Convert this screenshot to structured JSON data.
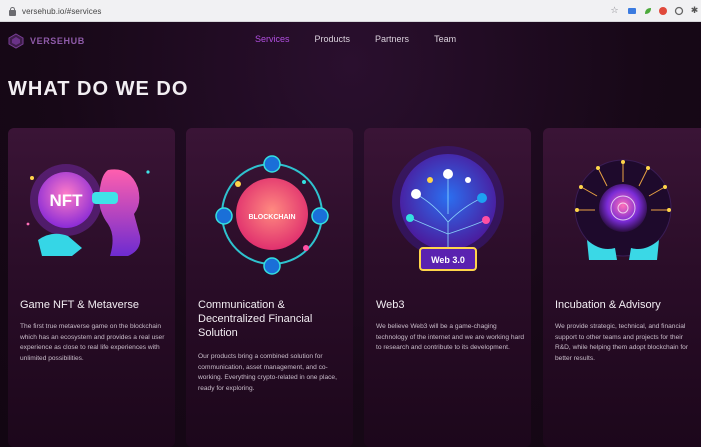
{
  "browser": {
    "url": "versehub.io/#services"
  },
  "nav": {
    "logo_text": "VERSEHUB",
    "links": [
      {
        "label": "Services",
        "active": true
      },
      {
        "label": "Products",
        "active": false
      },
      {
        "label": "Partners",
        "active": false
      },
      {
        "label": "Team",
        "active": false
      }
    ]
  },
  "section": {
    "heading": "WHAT DO WE DO"
  },
  "cards": [
    {
      "title": "Game NFT & Metaverse",
      "badge": "NFT",
      "description": "The first true metaverse game on the blockchain which has an ecosystem and provides a real user experience as close to real life experiences with unlimited possibilities."
    },
    {
      "title": "Communication & Decentralized Financial Solution",
      "badge": "BLOCKCHAIN",
      "description": "Our products bring a combined solution for communication, asset management, and co-working. Everything crypto-related in one place, ready for exploring."
    },
    {
      "title": "Web3",
      "badge": "Web 3.0",
      "description": "We believe Web3 will be a game-chaging technology of the internet and we are working hard to research and contribute to its development."
    },
    {
      "title": "Incubation & Advisory",
      "badge": "",
      "description": "We provide strategic, technical, and financial support to other teams and projects for their R&D, while helping them adopt blockchain for better results."
    }
  ],
  "colors": {
    "background": "#170817",
    "card": "#2a0d28",
    "accent": "#b14fe0",
    "nft_pink": "#ff4fa3",
    "cyan": "#33e0e0",
    "web3_yellow": "#ffd54a"
  }
}
